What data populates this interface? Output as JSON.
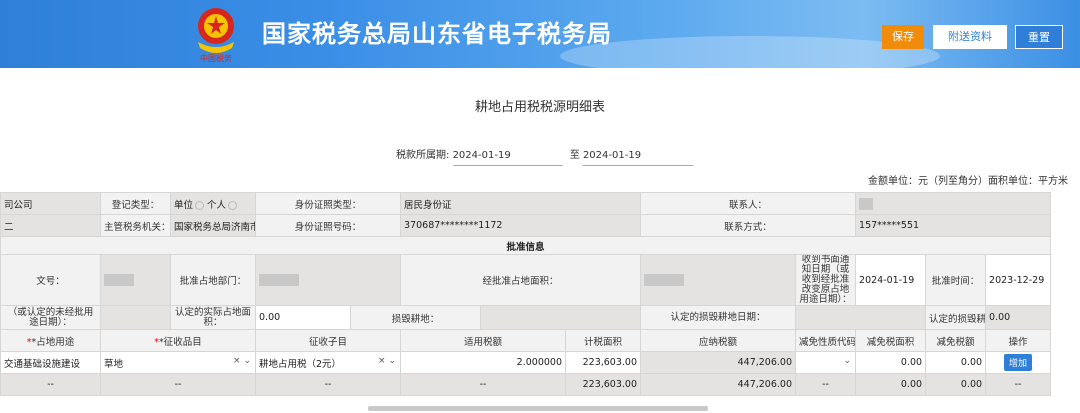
{
  "header": {
    "site_title": "国家税务总局山东省电子税务局",
    "emblem_caption": "中国税务",
    "buttons": {
      "save": "保存",
      "attach": "附送资料",
      "reset": "重置"
    }
  },
  "page_title": "耕地占用税税源明细表",
  "period": {
    "label": "税款所属期:",
    "start": "2024-01-19",
    "to": "至",
    "end": "2024-01-19"
  },
  "unit_note": "金额单位：元（列至角分）面积单位：平方米",
  "info": {
    "company": "司公司",
    "reg_type_label": "登记类型：",
    "reg_type_opt1": "单位",
    "reg_type_opt2": "个人",
    "id_type_label": "身份证照类型：",
    "id_type_value": "居民身份证",
    "contact_label": "联系人：",
    "row2_left": "二",
    "tax_authority_label": "主管税务机关：",
    "tax_authority_value": "国家税务总局济南市",
    "id_number_label": "身份证照号码：",
    "id_number_value": "370687********1172",
    "phone_label": "联系方式：",
    "phone_value": "157*****551"
  },
  "approval": {
    "section_title": "批准信息",
    "doc_no_label": "文号：",
    "dept_label": "批准占地部门：",
    "approved_area_label": "经批准占地面积：",
    "notice_date_label": "收到书面通知日期（或收到经批准改变原占地用途日期）：",
    "notice_date_value": "2024-01-19",
    "approve_time_label": "批准时间：",
    "approve_time_value": "2023-12-29",
    "unapproved_label": "（或认定的未经批用途日期）：",
    "actual_area_label": "认定的实际占地面积：",
    "actual_area_value": "0.00",
    "damaged_label": "损毁耕地：",
    "damaged_date_label": "认定的损毁耕地日期：",
    "damaged_area_label": "认定的损毁耕地面积：",
    "damaged_area_value": "0.00"
  },
  "grid": {
    "headers": [
      "*占地用途",
      "*征收品目",
      "征收子目",
      "适用税额",
      "计税面积",
      "应纳税额",
      "减免性质代码",
      "减免税面积",
      "减免税额",
      "操作"
    ],
    "row": {
      "use": "交通基础设施建设",
      "item": "草地",
      "sub_item": "耕地占用税（2元）",
      "rate": "2.000000",
      "area": "223,603.00",
      "tax": "447,206.00",
      "relief_code": "",
      "relief_area": "0.00",
      "relief_tax": "0.00",
      "action": "增加"
    },
    "total": {
      "use": "--",
      "item": "--",
      "sub_item": "--",
      "rate": "--",
      "area": "223,603.00",
      "tax": "447,206.00",
      "relief_code": "--",
      "relief_area": "0.00",
      "relief_tax": "0.00",
      "action": "--"
    }
  },
  "icons": {
    "clear": "×",
    "dropdown": "⌄"
  },
  "colors": {
    "header_blue": "#2f7fd8",
    "save_orange": "#f08c0a",
    "required_red": "#ee0000"
  }
}
